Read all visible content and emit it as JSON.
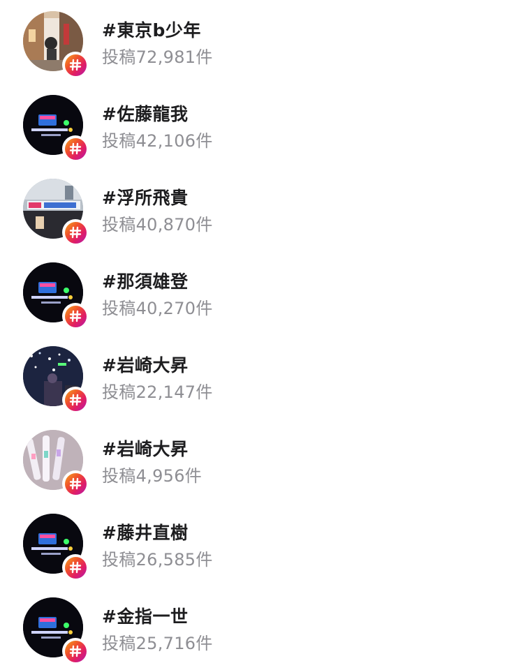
{
  "hashtags": [
    {
      "tag": "#東京b少年",
      "count": "投稿72,981件",
      "thumbnail": "street-scene"
    },
    {
      "tag": "#佐藤龍我",
      "count": "投稿42,106件",
      "thumbnail": "concert-penlight"
    },
    {
      "tag": "#浮所飛貴",
      "count": "投稿40,870件",
      "thumbnail": "storefront-sign"
    },
    {
      "tag": "#那須雄登",
      "count": "投稿40,270件",
      "thumbnail": "concert-penlight"
    },
    {
      "tag": "#岩崎大昇",
      "count": "投稿22,147件",
      "thumbnail": "stage-lights"
    },
    {
      "tag": "#岩崎大昇",
      "count": "投稿4,956件",
      "thumbnail": "penlight-sticks"
    },
    {
      "tag": "#藤井直樹",
      "count": "投稿26,585件",
      "thumbnail": "concert-penlight"
    },
    {
      "tag": "#金指一世",
      "count": "投稿25,716件",
      "thumbnail": "concert-penlight"
    }
  ],
  "icons": {
    "badge": "hashtag-icon"
  },
  "colors": {
    "tag_text": "#1d1d1f",
    "count_text": "#8e8e93",
    "badge_gradient": [
      "#f5a623",
      "#f0542a",
      "#e21e62",
      "#b21bae"
    ]
  }
}
